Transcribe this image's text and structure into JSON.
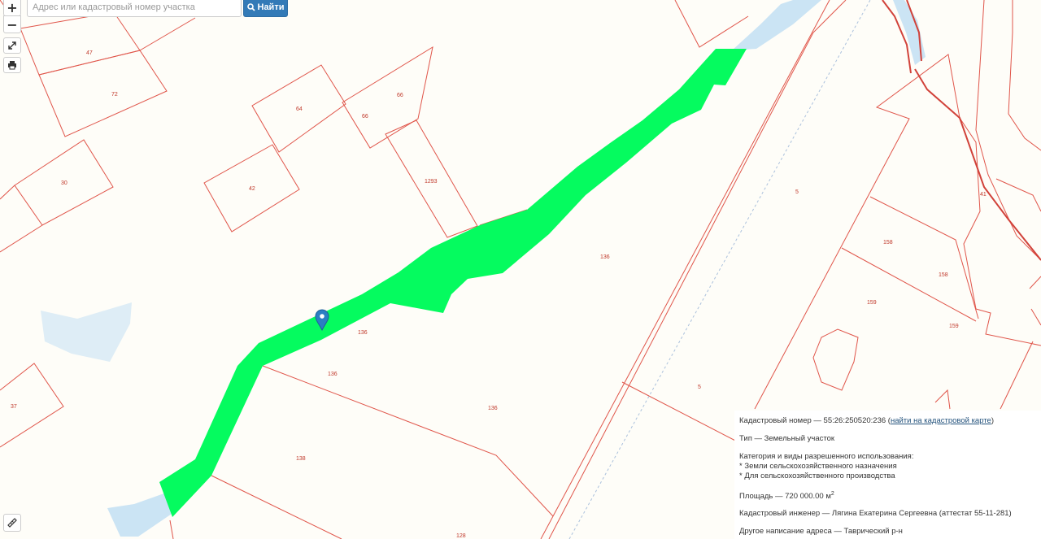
{
  "search": {
    "placeholder": "Адрес или кадастровый номер участка",
    "button_label": "Найти"
  },
  "controls": {
    "zoom_in": "+",
    "zoom_out": "−"
  },
  "colors": {
    "background": "#fefdf8",
    "parcel_border": "#e0554a",
    "highlight_parcel": "#05fb5f",
    "water": "#cbe4f4",
    "marker": "#2b7fc3"
  },
  "parcel_labels": [
    "47",
    "72",
    "64",
    "66",
    "66",
    "1293",
    "42",
    "30",
    "136",
    "136",
    "136",
    "136",
    "138",
    "37",
    "5",
    "5",
    "41",
    "158",
    "158",
    "159",
    "159",
    "128"
  ],
  "info": {
    "cadastral_label": "Кадастровый номер — 55:26:250520:236 (",
    "cadastral_link": "найти на кадастровой карте",
    "cadastral_end": ")",
    "type": "Тип — Земельный участок",
    "category_title": "Категория и виды разрешенного использования:",
    "category_1": "* Земли сельскохозяйственного назначения",
    "category_2": "* Для сельскохозяйственного производства",
    "area_label": "Площадь — 720 000.00 м",
    "area_unit_sup": "2",
    "engineer": "Кадастровый инженер — Лягина Екатерина Сергеевна (аттестат 55-11-281)",
    "alt_address": "Другое написание адреса — Таврический р-н"
  }
}
